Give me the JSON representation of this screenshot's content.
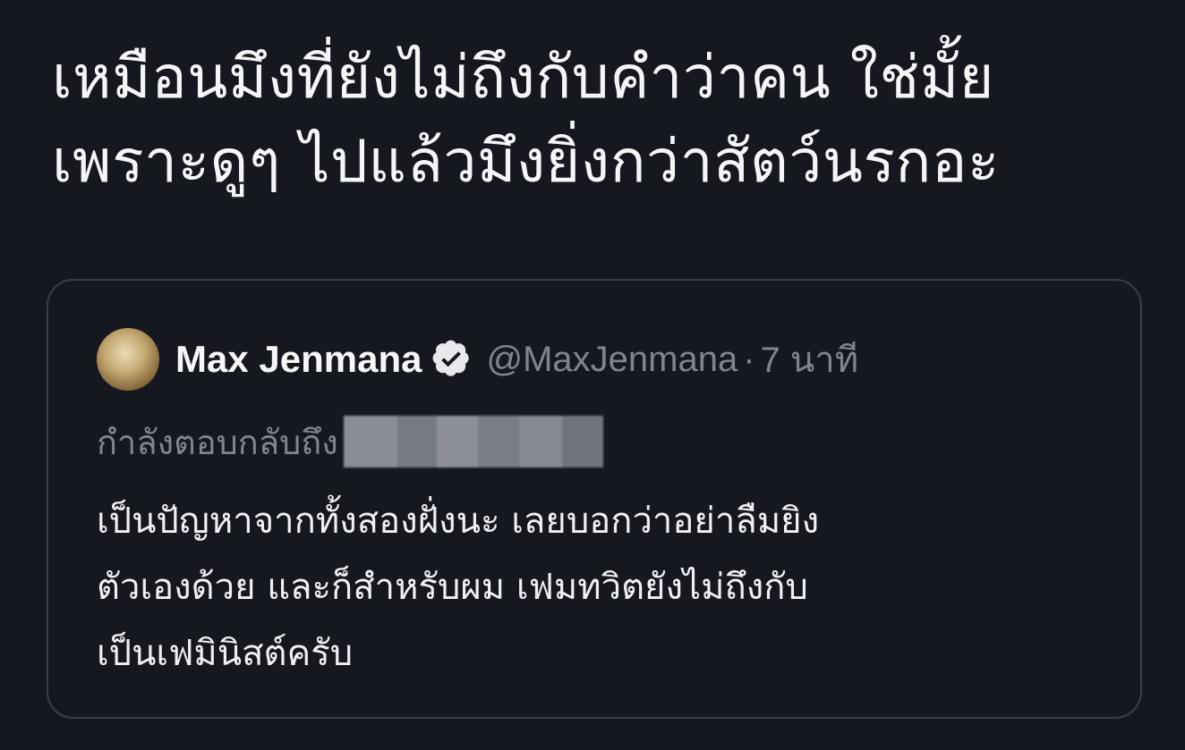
{
  "main_post": {
    "lines": [
      "เหมือนมึงที่ยังไม่ถึงกับคำว่าคน ใช่มั้ย",
      "เพราะดูๆ ไปแล้วมึงยิ่งกว่าสัตว์นรกอะ"
    ]
  },
  "quoted_tweet": {
    "display_name": "Max Jenmana",
    "verified_icon": "verified-badge-icon",
    "handle": "@MaxJenmana",
    "separator": "·",
    "time": "7 นาที",
    "reply_label": "กำลังตอบกลับถึง",
    "body_lines": [
      "เป็นปัญหาจากทั้งสองฝั่งนะ เลยบอกว่าอย่าลืมยิง",
      "ตัวเองด้วย และก็สำหรับผม เฟมทวิตยังไม่ถึงกับ",
      "เป็นเฟมินิสต์ครับ"
    ]
  },
  "colors": {
    "background": "#15181f",
    "primary_text": "#f4f5f7",
    "secondary_text": "#7f858e",
    "card_border": "#3a3f47"
  }
}
